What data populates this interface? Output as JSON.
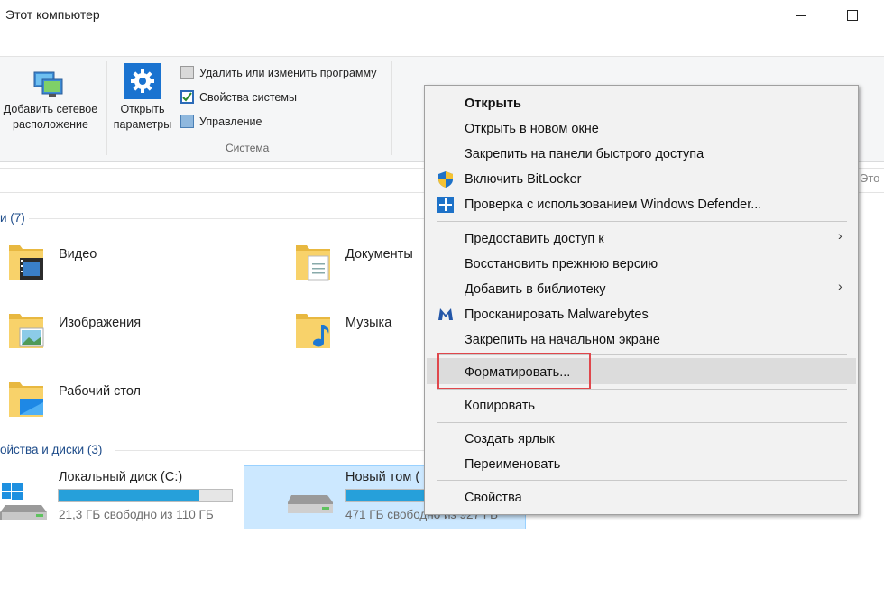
{
  "window": {
    "title": "Этот компьютер"
  },
  "ribbon": {
    "add_network": "Добавить сетевое расположение",
    "add_network_l1": "Добавить сетевое",
    "add_network_l2": "расположение",
    "open_params_l1": "Открыть",
    "open_params_l2": "параметры",
    "uninstall": "Удалить или изменить программу",
    "sys_props": "Свойства системы",
    "manage": "Управление",
    "group_system": "Система"
  },
  "search": {
    "placeholder": "Это"
  },
  "sections": {
    "folders": "и (7)",
    "drives": "ойства и диски (3)"
  },
  "folders": [
    {
      "name": "Видео",
      "icon": "video-folder-icon"
    },
    {
      "name": "Документы",
      "icon": "documents-folder-icon"
    },
    {
      "name": "Изображения",
      "icon": "pictures-folder-icon"
    },
    {
      "name": "Музыка",
      "icon": "music-folder-icon"
    },
    {
      "name": "Рабочий стол",
      "icon": "desktop-folder-icon"
    }
  ],
  "drives": [
    {
      "name": "Локальный диск (C:)",
      "free": "21,3 ГБ свободно из 110 ГБ",
      "used_fraction": 0.81
    },
    {
      "name": "Новый том (",
      "free": "471 ГБ свободно из 927 ГБ",
      "used_fraction": 0.49
    }
  ],
  "context_menu": {
    "open": "Открыть",
    "open_new_window": "Открыть в новом окне",
    "pin_quick_access": "Закрепить на панели быстрого доступа",
    "bitlocker": "Включить BitLocker",
    "defender": "Проверка с использованием Windows Defender...",
    "share": "Предоставить доступ к",
    "restore": "Восстановить прежнюю версию",
    "add_library": "Добавить в библиотеку",
    "malwarebytes": "Просканировать Malwarebytes",
    "pin_start": "Закрепить на начальном экране",
    "format": "Форматировать...",
    "copy": "Копировать",
    "shortcut": "Создать ярлык",
    "rename": "Переименовать",
    "properties": "Свойства"
  },
  "colors": {
    "accent": "#26a0da",
    "selection": "#cce8ff",
    "highlight_box": "#e0474c"
  }
}
